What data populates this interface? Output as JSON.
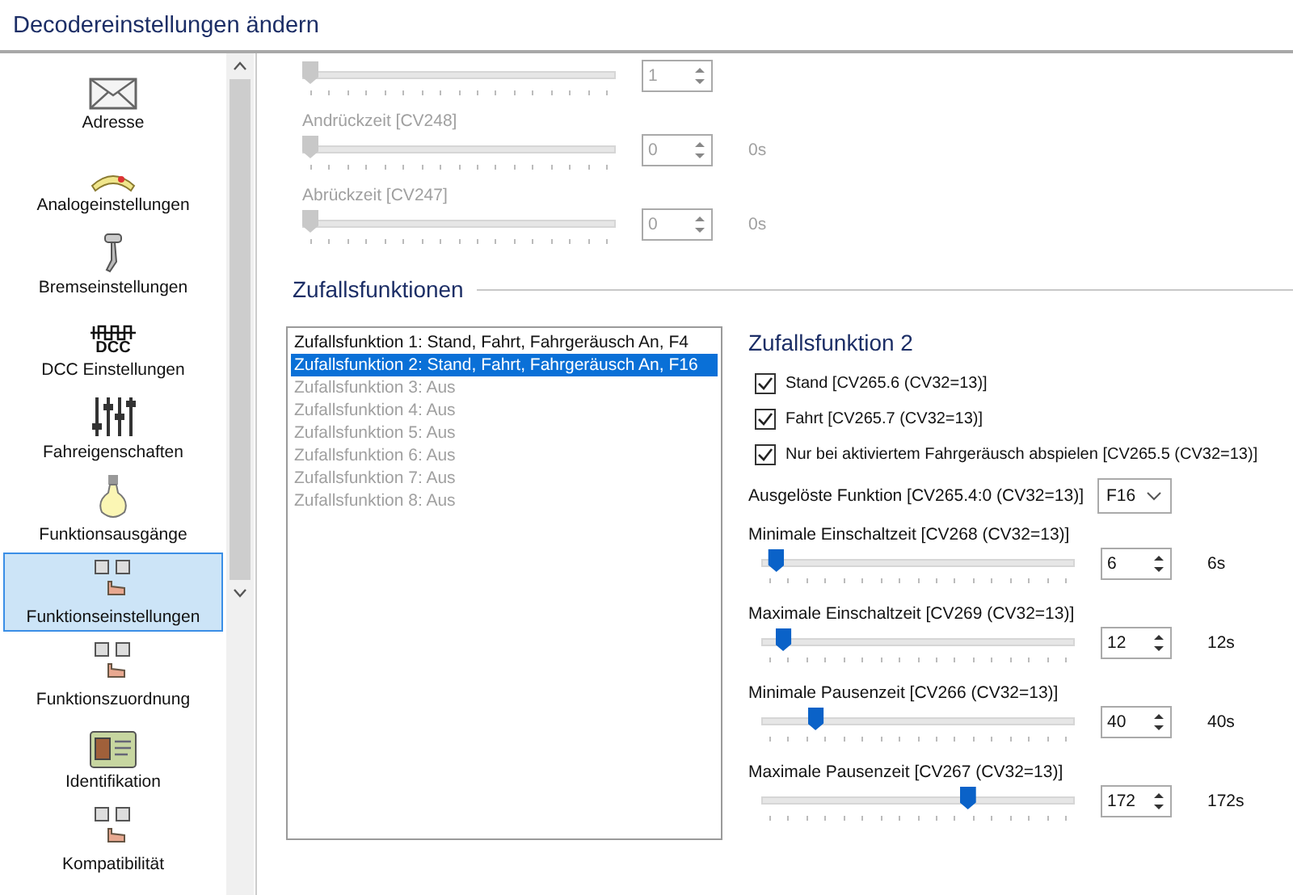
{
  "window": {
    "title": "Decodereinstellungen ändern"
  },
  "sidebar": {
    "items": [
      {
        "label": "Adresse",
        "kind": "envelope",
        "selected": false
      },
      {
        "label": "Analogeinstellungen",
        "kind": "gauge",
        "selected": false
      },
      {
        "label": "Bremseinstellungen",
        "kind": "brake",
        "selected": false
      },
      {
        "label": "DCC Einstellungen",
        "kind": "dcc",
        "icon_text": "DCC",
        "selected": false
      },
      {
        "label": "Fahreigenschaften",
        "kind": "sliders",
        "selected": false
      },
      {
        "label": "Funktionsausgänge",
        "kind": "bulb",
        "selected": false
      },
      {
        "label": "Funktionseinstellungen",
        "kind": "keys",
        "selected": true
      },
      {
        "label": "Funktionszuordnung",
        "kind": "keys",
        "selected": false
      },
      {
        "label": "Identifikation",
        "kind": "card",
        "selected": false
      },
      {
        "label": "Kompatibilität",
        "kind": "keys",
        "selected": false
      }
    ]
  },
  "upper_sliders": [
    {
      "value": "1",
      "level": 0,
      "disabled": true
    },
    {
      "label": "Andrückzeit [CV248]",
      "value": "0",
      "reading": "0s",
      "level": 0,
      "disabled": true
    },
    {
      "label": "Abrückzeit [CV247]",
      "value": "0",
      "reading": "0s",
      "level": 0,
      "disabled": true
    }
  ],
  "random_functions": {
    "title": "Zufallsfunktionen",
    "list": [
      {
        "text": "Zufallsfunktion 1: Stand, Fahrt, Fahrgeräusch An, F4",
        "enabled": true,
        "selected": false
      },
      {
        "text": "Zufallsfunktion 2: Stand, Fahrt, Fahrgeräusch An, F16",
        "enabled": true,
        "selected": true
      },
      {
        "text": "Zufallsfunktion 3: Aus",
        "enabled": false,
        "selected": false
      },
      {
        "text": "Zufallsfunktion 4: Aus",
        "enabled": false,
        "selected": false
      },
      {
        "text": "Zufallsfunktion 5: Aus",
        "enabled": false,
        "selected": false
      },
      {
        "text": "Zufallsfunktion 6: Aus",
        "enabled": false,
        "selected": false
      },
      {
        "text": "Zufallsfunktion 7: Aus",
        "enabled": false,
        "selected": false
      },
      {
        "text": "Zufallsfunktion 8: Aus",
        "enabled": false,
        "selected": false
      }
    ],
    "detail": {
      "title": "Zufallsfunktion 2",
      "checkboxes": [
        {
          "label": "Stand [CV265.6 (CV32=13)]",
          "checked": true
        },
        {
          "label": "Fahrt [CV265.7 (CV32=13)]",
          "checked": true
        },
        {
          "label": "Nur bei aktiviertem Fahrgeräusch abspielen [CV265.5 (CV32=13)]",
          "checked": true
        }
      ],
      "trigger": {
        "label": "Ausgelöste Funktion [CV265.4:0 (CV32=13)]",
        "value": "F16"
      },
      "sliders": [
        {
          "label": "Minimale Einschaltzeit [CV268 (CV32=13)]",
          "value": "6",
          "reading": "6s",
          "level": 0.024,
          "disabled": false
        },
        {
          "label": "Maximale Einschaltzeit [CV269 (CV32=13)]",
          "value": "12",
          "reading": "12s",
          "level": 0.047,
          "disabled": false
        },
        {
          "label": "Minimale Pausenzeit [CV266 (CV32=13)]",
          "value": "40",
          "reading": "40s",
          "level": 0.157,
          "disabled": false
        },
        {
          "label": "Maximale Pausenzeit [CV267 (CV32=13)]",
          "value": "172",
          "reading": "172s",
          "level": 0.675,
          "disabled": false
        }
      ]
    }
  }
}
